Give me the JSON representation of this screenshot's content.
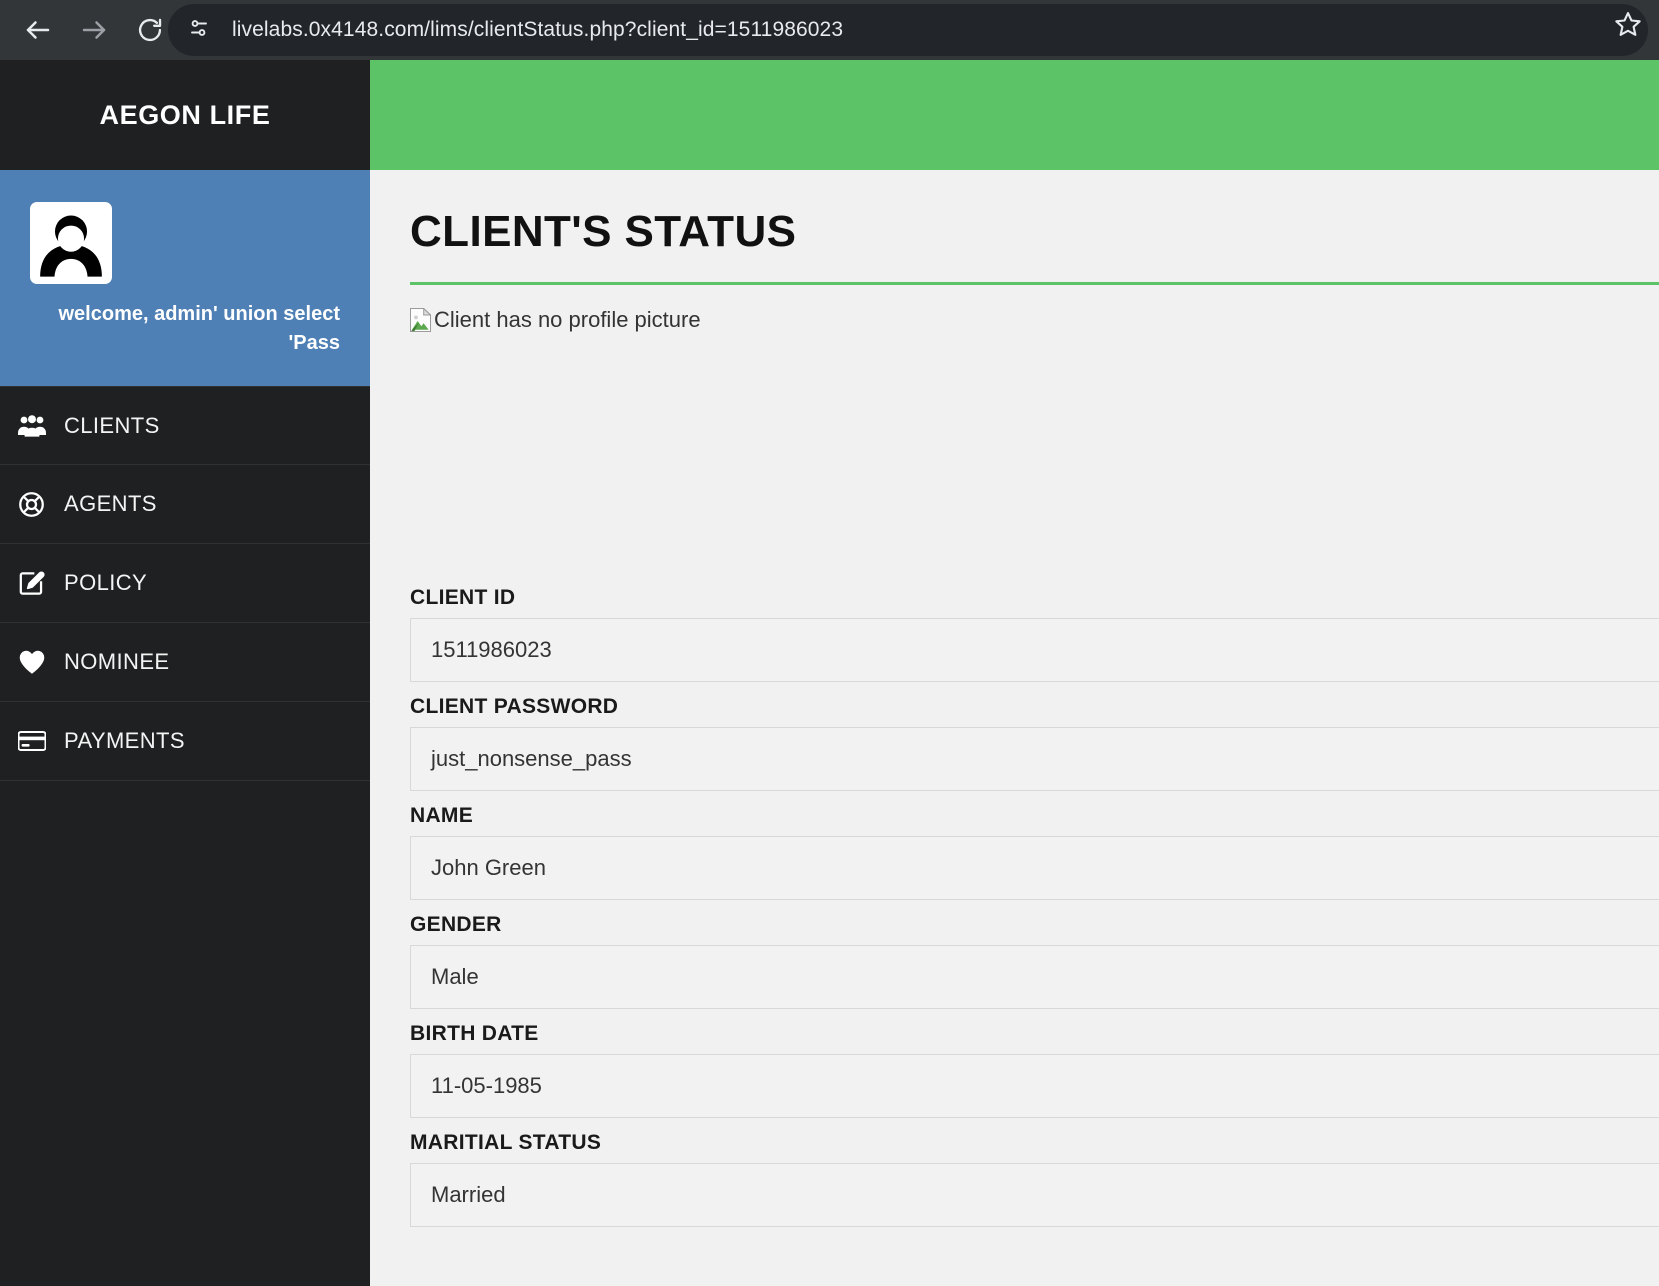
{
  "browser": {
    "back_icon": "arrow-left-icon",
    "forward_icon": "arrow-right-icon",
    "reload_icon": "reload-icon",
    "site_info_icon": "site-settings-tune-icon",
    "url": "livelabs.0x4148.com/lims/clientStatus.php?client_id=1511986023",
    "bookmark_icon": "star-outline-icon"
  },
  "sidebar": {
    "brand": "AEGON LIFE",
    "profile": {
      "avatar_icon": "user-avatar-icon",
      "welcome_text": "welcome, admin' union select 'Pass"
    },
    "items": [
      {
        "label": "CLIENTS",
        "icon": "users-group-icon"
      },
      {
        "label": "AGENTS",
        "icon": "life-ring-icon"
      },
      {
        "label": "POLICY",
        "icon": "pen-square-icon"
      },
      {
        "label": "NOMINEE",
        "icon": "heart-icon"
      },
      {
        "label": "PAYMENTS",
        "icon": "credit-card-icon"
      }
    ]
  },
  "main": {
    "title": "CLIENT'S STATUS",
    "profile_image_alt": "Client has no profile picture",
    "broken_image_icon": "broken-image-icon",
    "fields": [
      {
        "label": "CLIENT ID",
        "value": "1511986023"
      },
      {
        "label": "CLIENT PASSWORD",
        "value": "just_nonsense_pass"
      },
      {
        "label": "NAME",
        "value": "John Green"
      },
      {
        "label": "GENDER",
        "value": "Male"
      },
      {
        "label": "BIRTH DATE",
        "value": "11-05-1985"
      },
      {
        "label": "MARITIAL STATUS",
        "value": "Married"
      }
    ]
  },
  "colors": {
    "accent_green": "#5cc467",
    "profile_blue": "#4e7fb5",
    "sidebar_dark": "#1f2021",
    "chrome_dark": "#323639"
  }
}
